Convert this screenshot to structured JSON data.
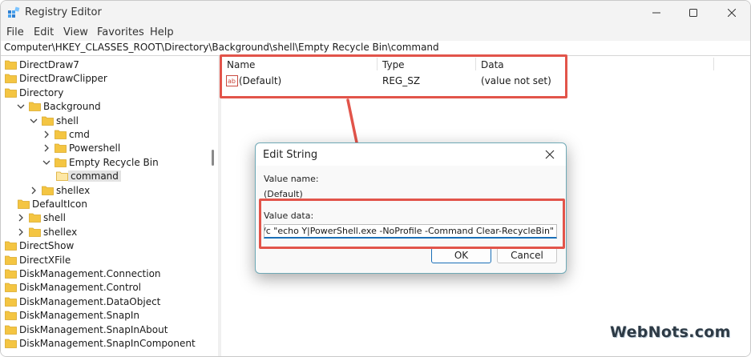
{
  "window": {
    "title": "Registry Editor"
  },
  "menu": [
    "File",
    "Edit",
    "View",
    "Favorites",
    "Help"
  ],
  "address": "Computer\\HKEY_CLASSES_ROOT\\Directory\\Background\\shell\\Empty Recycle Bin\\command",
  "tree": [
    {
      "label": "DirectDraw7",
      "chev": "none"
    },
    {
      "label": "DirectDrawClipper",
      "chev": "none"
    },
    {
      "label": "Directory",
      "chev": "none"
    },
    {
      "label": "Background",
      "chev": "down"
    },
    {
      "label": "shell",
      "chev": "down"
    },
    {
      "label": "cmd",
      "chev": "right"
    },
    {
      "label": "Powershell",
      "chev": "right"
    },
    {
      "label": "Empty Recycle Bin",
      "chev": "down"
    },
    {
      "label": "command",
      "chev": "none",
      "selected": true
    },
    {
      "label": "shellex",
      "chev": "right"
    },
    {
      "label": "DefaultIcon",
      "chev": "none"
    },
    {
      "label": "shell",
      "chev": "right"
    },
    {
      "label": "shellex",
      "chev": "right"
    },
    {
      "label": "DirectShow",
      "chev": "none"
    },
    {
      "label": "DirectXFile",
      "chev": "none"
    },
    {
      "label": "DiskManagement.Connection",
      "chev": "none"
    },
    {
      "label": "DiskManagement.Control",
      "chev": "none"
    },
    {
      "label": "DiskManagement.DataObject",
      "chev": "none"
    },
    {
      "label": "DiskManagement.SnapIn",
      "chev": "none"
    },
    {
      "label": "DiskManagement.SnapInAbout",
      "chev": "none"
    },
    {
      "label": "DiskManagement.SnapInComponent",
      "chev": "none"
    }
  ],
  "list": {
    "columns": [
      "Name",
      "Type",
      "Data"
    ],
    "rows": [
      {
        "name": "(Default)",
        "type": "REG_SZ",
        "data": "(value not set)"
      }
    ]
  },
  "dialog": {
    "title": "Edit String",
    "value_name_label": "Value name:",
    "value_name": "(Default)",
    "value_data_label": "Value data:",
    "value_data": "nd.exe /c \"echo Y|PowerShell.exe -NoProfile -Command Clear-RecycleBin\"",
    "ok_label": "OK",
    "cancel_label": "Cancel"
  },
  "watermark": "WebNots.com",
  "colors": {
    "accent": "#1a6fb8",
    "highlight": "#e2544a",
    "folder": "#f4c542"
  }
}
